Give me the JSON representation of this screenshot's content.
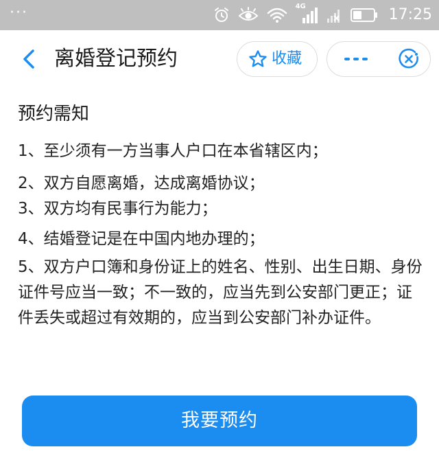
{
  "status_bar": {
    "menu_dots": "···",
    "network_label": "4G",
    "time": "17:25"
  },
  "nav": {
    "title": "离婚登记预约",
    "favorite_label": "收藏"
  },
  "notice": {
    "title": "预约需知",
    "items": [
      "1、至少须有一方当事人户口在本省辖区内；",
      "2、双方自愿离婚，达成离婚协议；",
      "3、双方均有民事行为能力；",
      "4、结婚登记是在中国内地办理的；",
      "5、双方户口簿和身份证上的姓名、性别、出生日期、身份证件号应当一致；不一致的，应当先到公安部门更正；证件丢失或超过有效期的，应当到公安部门补办证件。"
    ]
  },
  "action": {
    "book_label": "我要预约"
  },
  "colors": {
    "accent": "#1b8cf0",
    "status_bar_bg": "#bfbfbf"
  }
}
